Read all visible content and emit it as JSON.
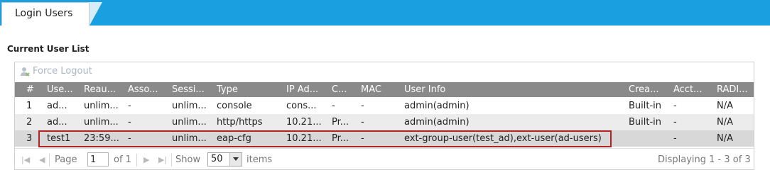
{
  "tab": {
    "label": "Login Users"
  },
  "section": {
    "title": "Current User List"
  },
  "toolbar": {
    "force_logout_label": "Force Logout"
  },
  "columns": [
    "#",
    "Use...",
    "Reau...",
    "Asso...",
    "Sessi...",
    "Type",
    "IP Ad...",
    "C...",
    "MAC",
    "User Info",
    "Crea...",
    "Acct...",
    "RADI..."
  ],
  "rows": [
    [
      "1",
      "ad...",
      "unlim...",
      "-",
      "unlim...",
      "console",
      "cons...",
      "-",
      "-",
      "admin(admin)",
      "Built-in",
      "-",
      "N/A"
    ],
    [
      "2",
      "ad...",
      "unlim...",
      "-",
      "unlim...",
      "http/https",
      "10.21...",
      "Pr...",
      "-",
      "admin(admin)",
      "Built-in",
      "-",
      "N/A"
    ],
    [
      "3",
      "test1",
      "23:59...",
      "-",
      "unlim...",
      "eap-cfg",
      "10.21...",
      "Pr...",
      "-",
      "ext-group-user(test_ad),ext-user(ad-users)",
      "",
      "-",
      "N/A"
    ]
  ],
  "pager": {
    "page_label": "Page",
    "page_value": "1",
    "of_label": "of 1",
    "show_label": "Show",
    "page_size": "50",
    "items_label": "items",
    "displaying": "Displaying 1 - 3 of 3"
  },
  "colors": {
    "tabbar": "#1aa0e0",
    "header": "#8a8a8a",
    "highlight": "#b22222"
  }
}
